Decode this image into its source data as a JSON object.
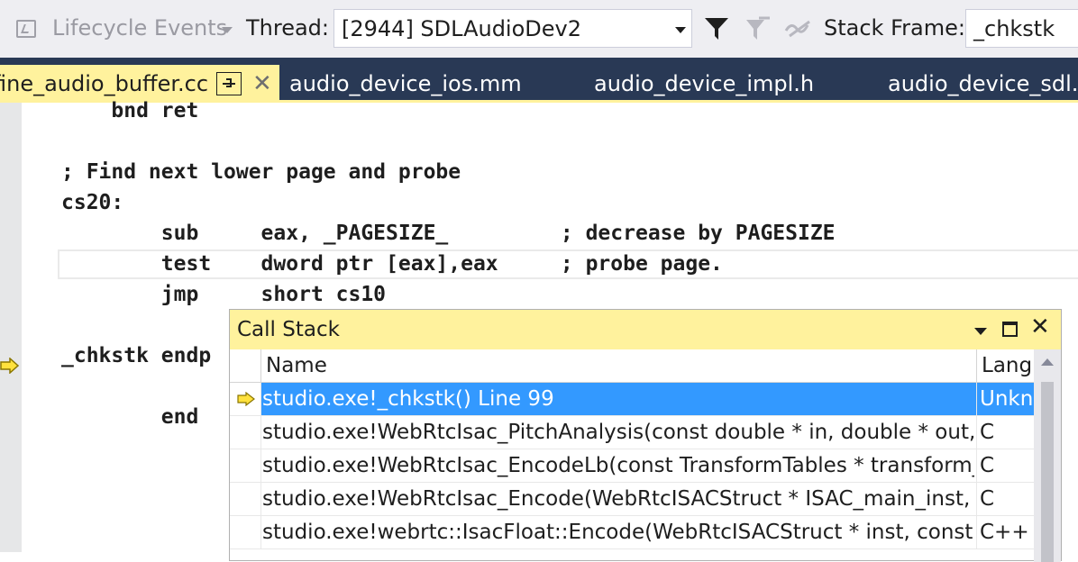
{
  "toolbar": {
    "lifecycle_label": "Lifecycle Events",
    "thread_label": "Thread:",
    "thread_value": "[2944] SDLAudioDev2",
    "stack_frame_label": "Stack Frame:",
    "stack_frame_value": "_chkstk"
  },
  "tabs": [
    {
      "label": "fine_audio_buffer.cc",
      "active": true
    },
    {
      "label": "audio_device_ios.mm"
    },
    {
      "label": "audio_device_impl.h"
    },
    {
      "label": "audio_device_sdl.h"
    }
  ],
  "close_glyph": "✕",
  "code": {
    "lines": [
      "    bnd ret",
      "",
      "; Find next lower page and probe",
      "cs20:",
      "        sub     eax, _PAGESIZE_         ; decrease by PAGESIZE",
      "        test    dword ptr [eax],eax     ; probe page.",
      "        jmp     short cs10",
      "",
      "_chkstk endp",
      "",
      "        end"
    ]
  },
  "call_stack": {
    "title": "Call Stack",
    "close_glyph": "✕",
    "columns": {
      "name": "Name",
      "lang": "Lang"
    },
    "rows": [
      {
        "name": "studio.exe!_chkstk() Line 99",
        "lang": "Unkn",
        "selected": true
      },
      {
        "name": "studio.exe!WebRtcIsac_PitchAnalysis(const double * in, double * out,",
        "lang": "C"
      },
      {
        "name": "studio.exe!WebRtcIsac_EncodeLb(const TransformTables * transform_t",
        "lang": "C"
      },
      {
        "name": "studio.exe!WebRtcIsac_Encode(WebRtcISACStruct * ISAC_main_inst, c",
        "lang": "C"
      },
      {
        "name": "studio.exe!webrtc::IsacFloat::Encode(WebRtcISACStruct * inst, const sh",
        "lang": "C++"
      }
    ]
  },
  "colors": {
    "accent_yellow": "#fff29d",
    "tab_well": "#293955",
    "selection": "#3399ff"
  }
}
